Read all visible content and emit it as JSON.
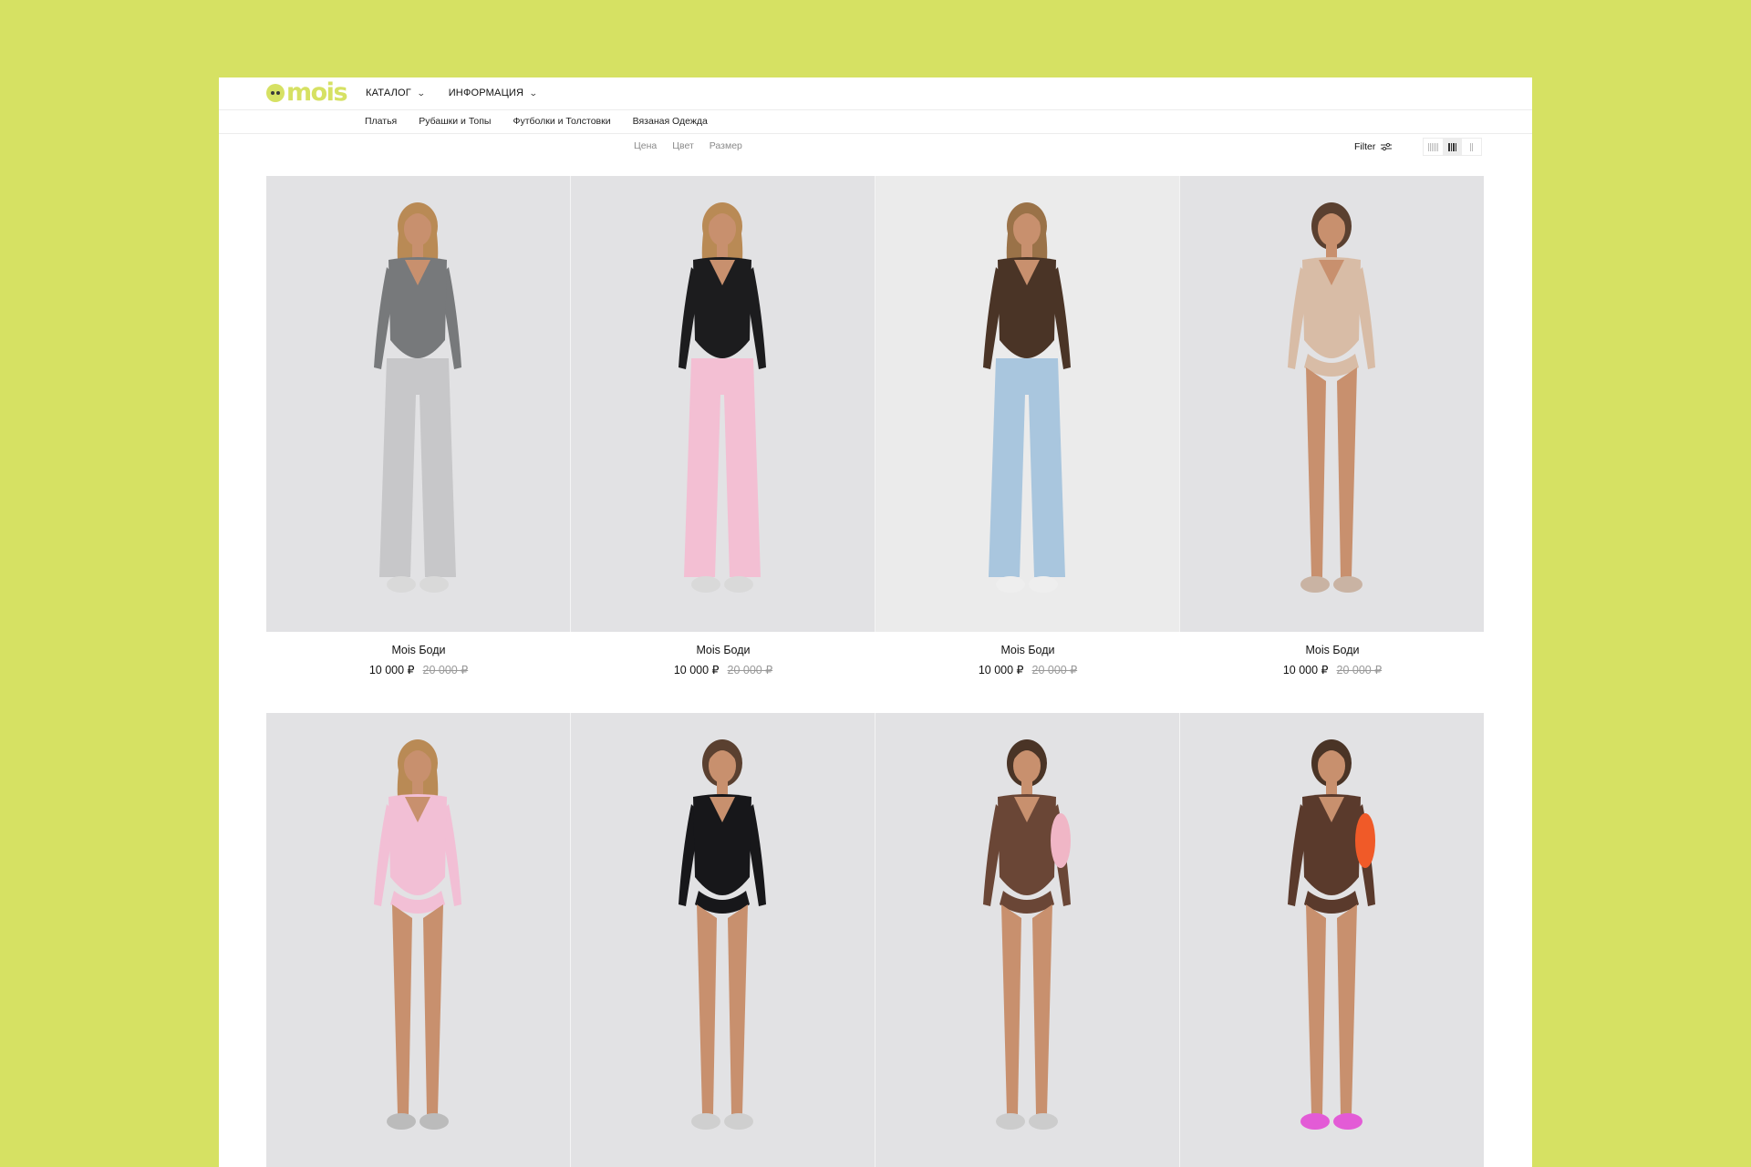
{
  "brand": {
    "logo_text": "mois"
  },
  "topnav": [
    {
      "label": "КАТАЛОГ"
    },
    {
      "label": "ИНФОРМАЦИЯ"
    }
  ],
  "subnav": [
    "Платья",
    "Рубашки и Топы",
    "Футболки и Толстовки",
    "Вязаная Одежда"
  ],
  "filters": [
    "Цена",
    "Цвет",
    "Размер"
  ],
  "filter_button": "Filter",
  "products": [
    {
      "name": "Mois Боди",
      "price": "10 000 ₽",
      "old_price": "20 000 ₽",
      "bg": "#e2e2e4",
      "hair": "#b98a55",
      "top": "#77797b",
      "bottom": "#c7c7c9",
      "pants": true,
      "shoes": "#d9d9d9"
    },
    {
      "name": "Mois Боди",
      "price": "10 000 ₽",
      "old_price": "20 000 ₽",
      "bg": "#e2e2e4",
      "hair": "#b98a55",
      "top": "#1c1c1e",
      "bottom": "#f3bfd3",
      "pants": true,
      "shoes": "#d9d9d9"
    },
    {
      "name": "Mois Боди",
      "price": "10 000 ₽",
      "old_price": "20 000 ₽",
      "bg": "#ebebeb",
      "hair": "#9a7248",
      "top": "#4a3426",
      "bottom": "#a9c6de",
      "pants": true,
      "shoes": "#eeeeee"
    },
    {
      "name": "Mois Боди",
      "price": "10 000 ₽",
      "old_price": "20 000 ₽",
      "bg": "#e2e2e4",
      "hair": "#5a4030",
      "top": "#d8bca6",
      "bottom": "#b9856a",
      "pants": false,
      "shoes": "#c9b3a3"
    },
    {
      "name": "",
      "price": "",
      "old_price": "",
      "bg": "#e2e2e4",
      "hair": "#b98a55",
      "top": "#f2bfd5",
      "bottom": "#b9856a",
      "pants": false,
      "shoes": "#bbbbbb"
    },
    {
      "name": "",
      "price": "",
      "old_price": "",
      "bg": "#e2e2e4",
      "hair": "#5a4030",
      "top": "#17171a",
      "bottom": "#b9856a",
      "pants": false,
      "shoes": "#cfcfcf"
    },
    {
      "name": "",
      "price": "",
      "old_price": "",
      "bg": "#e2e2e4",
      "hair": "#4a3426",
      "top": "#6a4636",
      "bottom": "#b9856a",
      "pants": false,
      "shoes": "#cccccc",
      "bag": "#f0b6c6"
    },
    {
      "name": "",
      "price": "",
      "old_price": "",
      "bg": "#e2e2e4",
      "hair": "#4a3426",
      "top": "#5a3a2c",
      "bottom": "#b9856a",
      "pants": false,
      "shoes": "#e35bd6",
      "bag": "#f05a28"
    }
  ],
  "colors": {
    "accent": "#d6e163"
  }
}
